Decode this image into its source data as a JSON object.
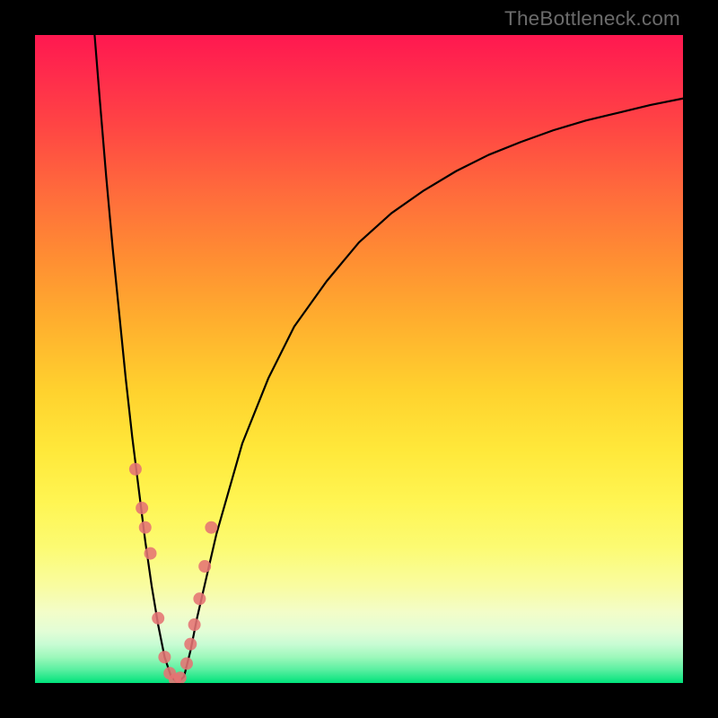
{
  "watermark": "TheBottleneck.com",
  "chart_data": {
    "type": "line",
    "title": "",
    "xlabel": "",
    "ylabel": "",
    "xlim": [
      0,
      100
    ],
    "ylim": [
      0,
      100
    ],
    "grid": false,
    "series": [
      {
        "name": "bottleneck-curve",
        "x": [
          9.2,
          10,
          11,
          12,
          13,
          14,
          15,
          16,
          17,
          18,
          19,
          20,
          21,
          22,
          23,
          24,
          25,
          28,
          32,
          36,
          40,
          45,
          50,
          55,
          60,
          65,
          70,
          75,
          80,
          85,
          90,
          95,
          100
        ],
        "values": [
          100,
          90,
          78,
          67,
          57,
          47,
          38,
          30,
          22,
          15,
          9,
          4,
          1,
          0,
          1,
          5,
          10,
          23,
          37,
          47,
          55,
          62,
          68,
          72.5,
          76,
          79,
          81.5,
          83.5,
          85.3,
          86.8,
          88,
          89.2,
          90.2
        ]
      }
    ],
    "points": {
      "name": "sample-points",
      "x": [
        15.5,
        16.5,
        17,
        17.8,
        19,
        20,
        20.8,
        21.6,
        22.4,
        23.4,
        24,
        24.6,
        25.4,
        26.2,
        27.2
      ],
      "values": [
        33,
        27,
        24,
        20,
        10,
        4,
        1.5,
        0.5,
        0.8,
        3,
        6,
        9,
        13,
        18,
        24
      ]
    }
  }
}
